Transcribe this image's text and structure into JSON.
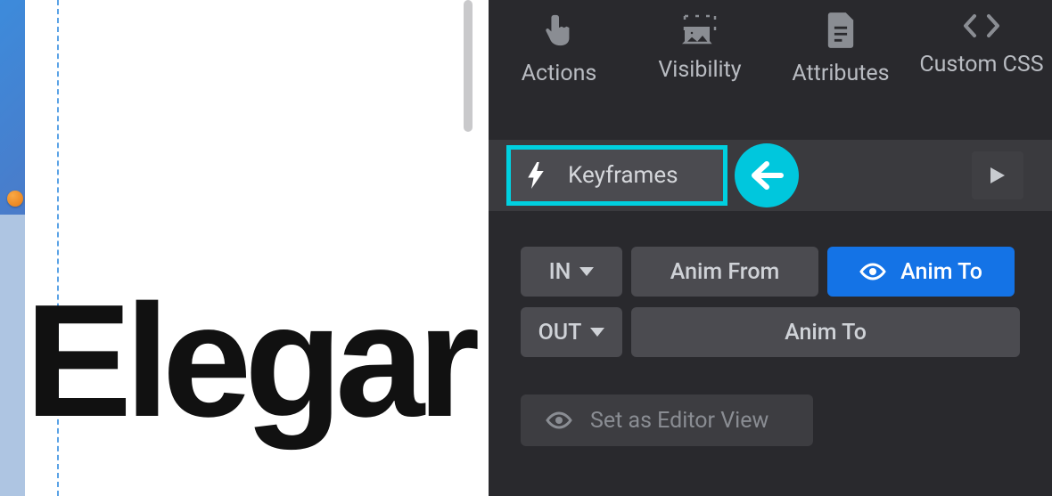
{
  "tabs": {
    "actions": "Actions",
    "visibility": "Visibility",
    "attributes": "Attributes",
    "custom_css": "Custom CSS"
  },
  "keyframes": {
    "label": "Keyframes"
  },
  "anim": {
    "in_label": "IN",
    "anim_from": "Anim From",
    "anim_to": "Anim To",
    "out_label": "OUT",
    "anim_to_out": "Anim To"
  },
  "editor_view": {
    "label": "Set as Editor View"
  },
  "canvas": {
    "big_text": "Elegar"
  }
}
